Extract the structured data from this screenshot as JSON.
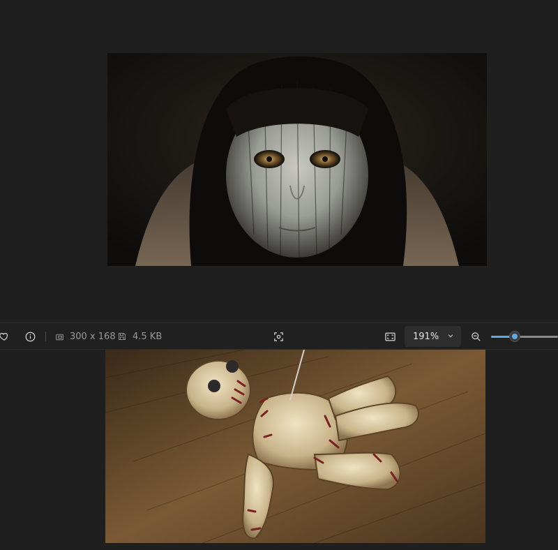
{
  "images": {
    "top": {
      "alt": ""
    },
    "bottom": {
      "alt": ""
    }
  },
  "toolbar": {
    "favorite_icon": "heart-icon",
    "info_icon": "info-icon",
    "dimensions_icon": "image-size-icon",
    "dimensions": "300 x 168",
    "filesize_icon": "save-icon",
    "filesize": "4.5 KB",
    "scan_icon": "scan-icon",
    "fit_icon": "fit-screen-icon",
    "zoom_value": "191%",
    "zoom_out_icon": "zoom-out-icon",
    "zoom_level": 0.35
  },
  "colors": {
    "background": "#1f1f1f",
    "toolbar": "#202020",
    "accent": "#60a9e6"
  }
}
